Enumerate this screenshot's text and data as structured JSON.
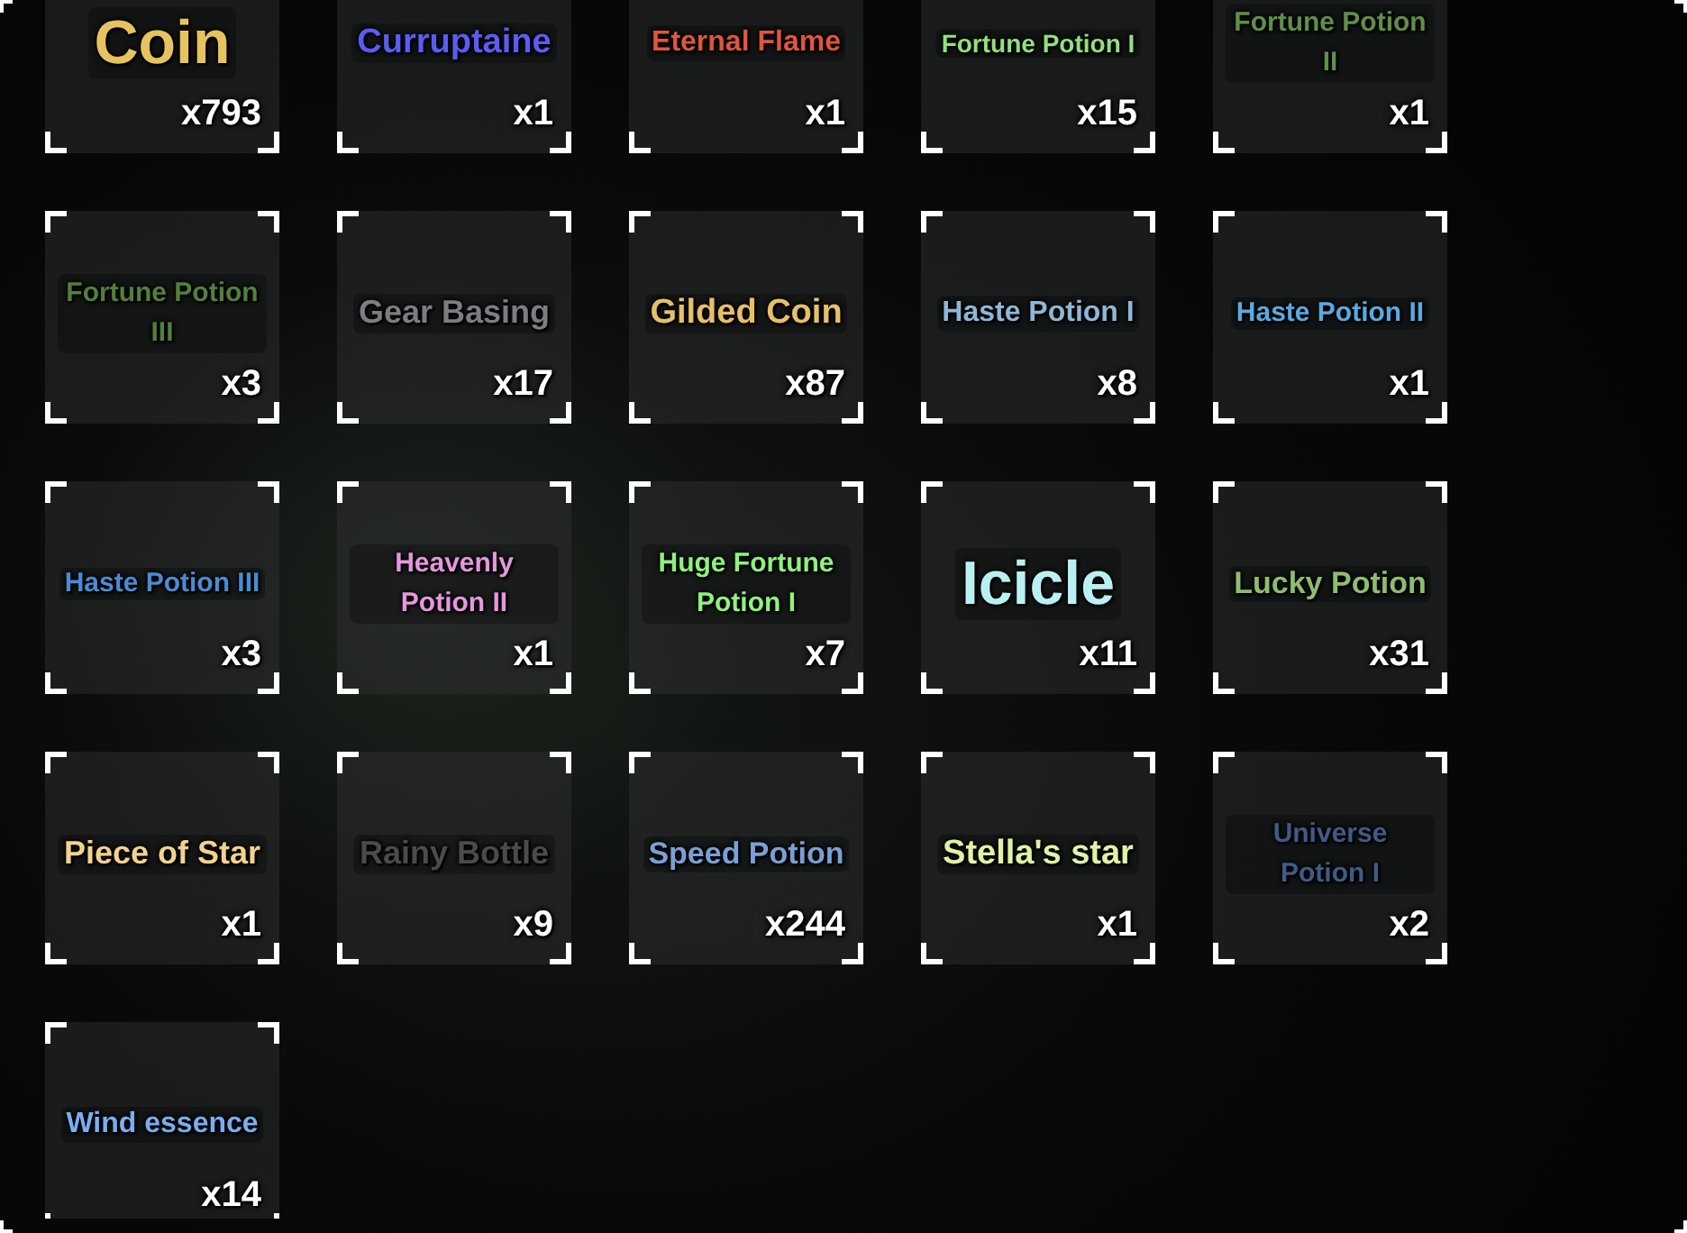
{
  "inventory": {
    "items": [
      {
        "name": "Coin",
        "count": "x793",
        "color": "#e6c35e"
      },
      {
        "name": "Curruptaine",
        "count": "x1",
        "color": "#5a5cf2"
      },
      {
        "name": "Eternal Flame",
        "count": "x1",
        "color": "#e0553c"
      },
      {
        "name": "Fortune Potion I",
        "count": "x15",
        "color": "#93e07d"
      },
      {
        "name": "Fortune Potion II",
        "count": "x1",
        "color": "#5f8f49"
      },
      {
        "name": "Fortune Potion III",
        "count": "x3",
        "color": "#52803c"
      },
      {
        "name": "Gear Basing",
        "count": "x17",
        "color": "#7c7c82"
      },
      {
        "name": "Gilded Coin",
        "count": "x87",
        "color": "#e6c067"
      },
      {
        "name": "Haste Potion I",
        "count": "x8",
        "color": "#8fb6d6"
      },
      {
        "name": "Haste Potion II",
        "count": "x1",
        "color": "#5ba9e2"
      },
      {
        "name": "Haste Potion III",
        "count": "x3",
        "color": "#4a8bd4"
      },
      {
        "name": "Heavenly Potion II",
        "count": "x1",
        "color": "#e796de"
      },
      {
        "name": "Huge Fortune Potion I",
        "count": "x7",
        "color": "#8ff27c"
      },
      {
        "name": "Icicle",
        "count": "x11",
        "color": "#b9f1f3"
      },
      {
        "name": "Lucky Potion",
        "count": "x31",
        "color": "#8dbe6e"
      },
      {
        "name": "Piece of Star",
        "count": "x1",
        "color": "#f2d28e"
      },
      {
        "name": "Rainy Bottle",
        "count": "x9",
        "color": "#4b4b4f"
      },
      {
        "name": "Speed Potion",
        "count": "x244",
        "color": "#7a9fd6"
      },
      {
        "name": "Stella's star",
        "count": "x1",
        "color": "#e2f1a6"
      },
      {
        "name": "Universe Potion I",
        "count": "x2",
        "color": "#3f5b87"
      },
      {
        "name": "Wind essence",
        "count": "x14",
        "color": "#79aef0"
      }
    ]
  }
}
